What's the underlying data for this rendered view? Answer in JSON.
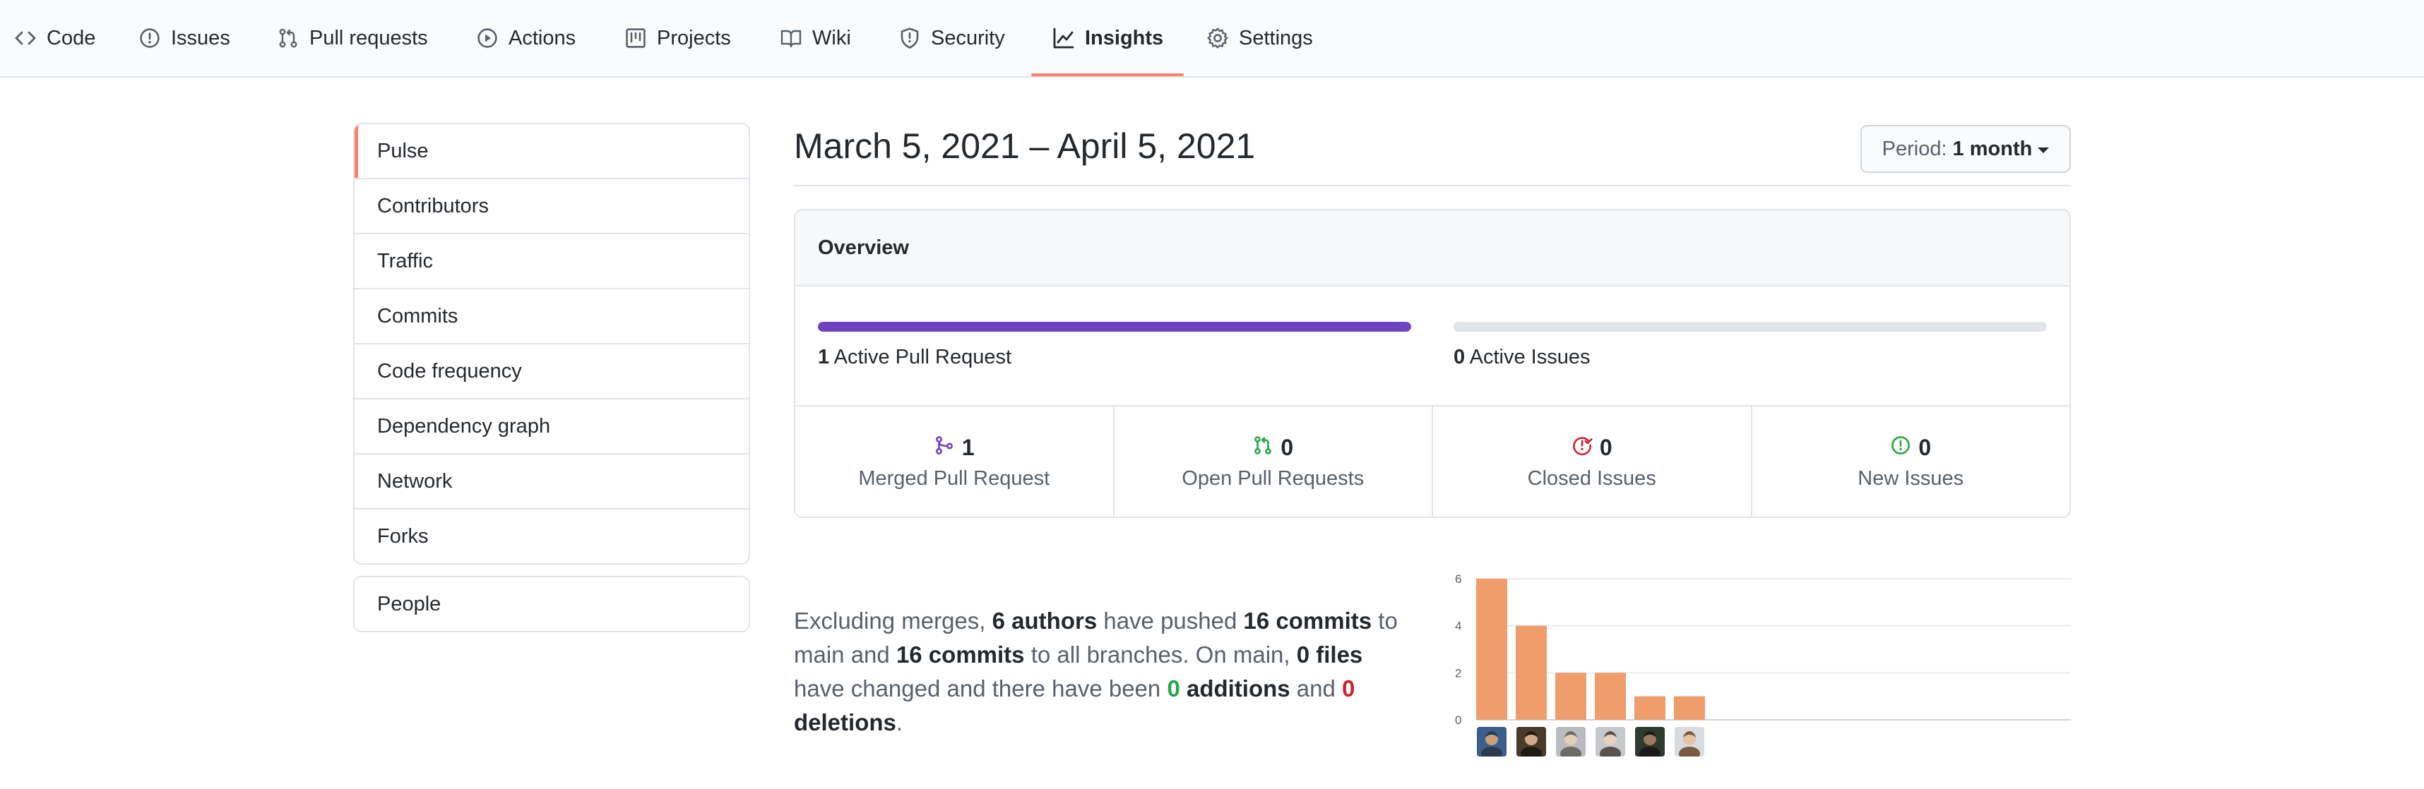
{
  "nav": {
    "items": [
      {
        "label": "Code",
        "icon": "code-icon"
      },
      {
        "label": "Issues",
        "icon": "issue-opened-icon"
      },
      {
        "label": "Pull requests",
        "icon": "git-pull-request-icon"
      },
      {
        "label": "Actions",
        "icon": "play-icon"
      },
      {
        "label": "Projects",
        "icon": "project-icon"
      },
      {
        "label": "Wiki",
        "icon": "book-icon"
      },
      {
        "label": "Security",
        "icon": "shield-icon"
      },
      {
        "label": "Insights",
        "icon": "graph-icon",
        "selected": true
      },
      {
        "label": "Settings",
        "icon": "gear-icon"
      }
    ],
    "accent": "#f9826c"
  },
  "sidebar": {
    "items": [
      "Pulse",
      "Contributors",
      "Traffic",
      "Commits",
      "Code frequency",
      "Dependency graph",
      "Network",
      "Forks"
    ],
    "selected": "Pulse",
    "people": "People"
  },
  "header": {
    "title": "March 5, 2021 – April 5, 2021",
    "period_label": "Period:",
    "period_value": "1 month"
  },
  "overview": {
    "title": "Overview",
    "pull_requests": {
      "count": "1",
      "label": "Active Pull Request",
      "fill_fraction": 1.0,
      "color": "#6f42c1"
    },
    "issues": {
      "count": "0",
      "label": "Active Issues",
      "fill_fraction": 0.0,
      "color": "#28a745"
    },
    "stats": [
      {
        "count": "1",
        "label": "Merged Pull Request",
        "icon": "git-merge-icon",
        "color": "#6f42c1"
      },
      {
        "count": "0",
        "label": "Open Pull Requests",
        "icon": "git-pull-request-icon",
        "color": "#28a745"
      },
      {
        "count": "0",
        "label": "Closed Issues",
        "icon": "issue-closed-icon",
        "color": "#cb2431"
      },
      {
        "count": "0",
        "label": "New Issues",
        "icon": "issue-opened-icon",
        "color": "#28a745"
      }
    ]
  },
  "summary": {
    "t1": "Excluding merges, ",
    "authors": "6 authors",
    "t2": " have pushed ",
    "commits_main": "16 commits",
    "t3": " to main and ",
    "commits_all": "16 commits",
    "t4": " to all branches. On main, ",
    "files": "0 files",
    "t5": " have changed and there have been ",
    "additions_num": "0",
    "additions_word": " additions",
    "t6": " and ",
    "deletions_num": "0",
    "deletions_word": " deletions",
    "t7": "."
  },
  "chart_data": {
    "type": "bar",
    "values": [
      6,
      4,
      2,
      2,
      1,
      1
    ],
    "ylim": [
      0,
      6
    ],
    "yticks": [
      "0",
      "2",
      "4",
      "6"
    ],
    "color": "#f09d6c",
    "grid": true
  }
}
